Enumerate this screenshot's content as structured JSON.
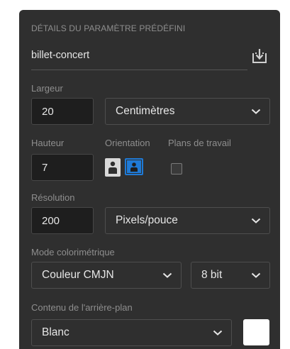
{
  "panel": {
    "section_title": "DÉTAILS DU PARAMÈTRE PRÉDÉFINI",
    "preset_name": "billet-concert",
    "save_icon": "save-preset-icon"
  },
  "width": {
    "label": "Largeur",
    "value": "20",
    "unit": "Centimètres"
  },
  "height": {
    "label": "Hauteur",
    "value": "7"
  },
  "orientation": {
    "label": "Orientation",
    "options": [
      "portrait",
      "landscape"
    ],
    "selected": "landscape"
  },
  "artboards": {
    "label": "Plans de travail",
    "checked": false
  },
  "resolution": {
    "label": "Résolution",
    "value": "200",
    "unit": "Pixels/pouce"
  },
  "color_mode": {
    "label": "Mode colorimétrique",
    "mode": "Couleur CMJN",
    "depth": "8 bit"
  },
  "background": {
    "label": "Contenu de l'arrière-plan",
    "value": "Blanc",
    "swatch_color": "#ffffff"
  },
  "colors": {
    "panel": "#2f2f2f",
    "selected_orientation": "#1f7ad6",
    "field_bg": "#1e1e1e"
  }
}
